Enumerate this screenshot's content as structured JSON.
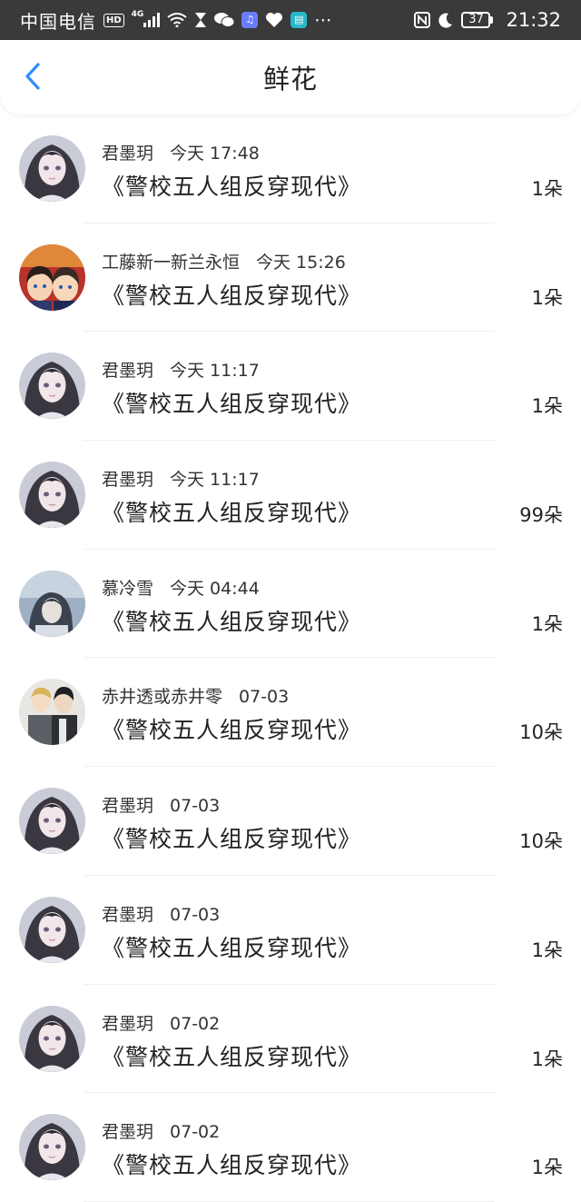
{
  "status_bar": {
    "carrier": "中国电信",
    "hd": "HD",
    "network": "4G",
    "battery": "37",
    "time": "21:32",
    "icons": [
      "signal-icon",
      "wifi-icon",
      "hourglass-icon",
      "wechat-icon",
      "music-app-icon",
      "health-icon",
      "reader-app-icon",
      "more-dots-icon",
      "nfc-icon",
      "moon-icon",
      "battery-icon"
    ]
  },
  "header": {
    "title": "鲜花",
    "back_icon": "chevron-left-icon",
    "accent": "#2f8cff"
  },
  "rows": [
    {
      "user": "君墨玥",
      "time": "今天 17:48",
      "book": "《警校五人组反穿现代》",
      "count": "1朵",
      "avatar": "anime-girl"
    },
    {
      "user": "工藤新一新兰永恒",
      "time": "今天 15:26",
      "book": "《警校五人组反穿现代》",
      "count": "1朵",
      "avatar": "couple-red"
    },
    {
      "user": "君墨玥",
      "time": "今天 11:17",
      "book": "《警校五人组反穿现代》",
      "count": "1朵",
      "avatar": "anime-girl"
    },
    {
      "user": "君墨玥",
      "time": "今天 11:17",
      "book": "《警校五人组反穿现代》",
      "count": "99朵",
      "avatar": "anime-girl"
    },
    {
      "user": "慕冷雪",
      "time": "今天 04:44",
      "book": "《警校五人组反穿现代》",
      "count": "1朵",
      "avatar": "blue-girl"
    },
    {
      "user": "赤井透或赤井零",
      "time": "07-03",
      "book": "《警校五人组反穿现代》",
      "count": "10朵",
      "avatar": "two-men"
    },
    {
      "user": "君墨玥",
      "time": "07-03",
      "book": "《警校五人组反穿现代》",
      "count": "10朵",
      "avatar": "anime-girl"
    },
    {
      "user": "君墨玥",
      "time": "07-03",
      "book": "《警校五人组反穿现代》",
      "count": "1朵",
      "avatar": "anime-girl"
    },
    {
      "user": "君墨玥",
      "time": "07-02",
      "book": "《警校五人组反穿现代》",
      "count": "1朵",
      "avatar": "anime-girl"
    },
    {
      "user": "君墨玥",
      "time": "07-02",
      "book": "《警校五人组反穿现代》",
      "count": "1朵",
      "avatar": "anime-girl"
    }
  ]
}
